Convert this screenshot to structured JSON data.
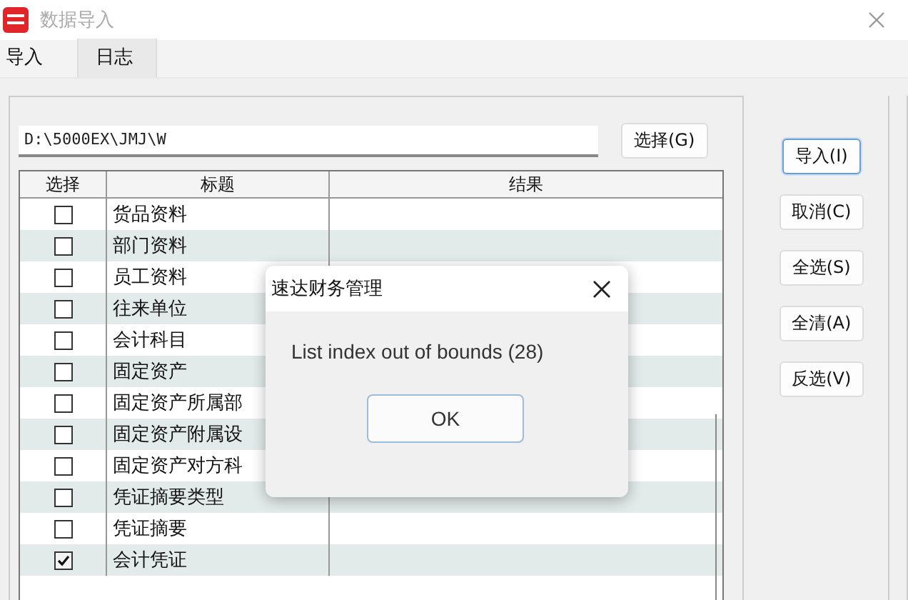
{
  "window": {
    "title": "数据导入"
  },
  "tabs": [
    {
      "label": "导入",
      "selected": true
    },
    {
      "label": "日志",
      "selected": false
    }
  ],
  "path_field": {
    "value": "D:\\5000EX\\JMJ\\W"
  },
  "browse_button": "选择(G)",
  "table": {
    "columns": [
      "选择",
      "标题",
      "结果"
    ],
    "rows": [
      {
        "title": "货品资料",
        "checked": false
      },
      {
        "title": "部门资料",
        "checked": false
      },
      {
        "title": "员工资料",
        "checked": false
      },
      {
        "title": "往来单位",
        "checked": false
      },
      {
        "title": "会计科目",
        "checked": false
      },
      {
        "title": "固定资产",
        "checked": false
      },
      {
        "title": "固定资产所属部",
        "checked": false
      },
      {
        "title": "固定资产附属设",
        "checked": false
      },
      {
        "title": "固定资产对方科",
        "checked": false
      },
      {
        "title": "凭证摘要类型",
        "checked": false
      },
      {
        "title": "凭证摘要",
        "checked": false
      },
      {
        "title": "会计凭证",
        "checked": true
      }
    ]
  },
  "side_buttons": [
    {
      "label": "导入(I)",
      "selected": true
    },
    {
      "label": "取消(C)",
      "selected": false
    },
    {
      "label": "全选(S)",
      "selected": false
    },
    {
      "label": "全清(A)",
      "selected": false
    },
    {
      "label": "反选(V)",
      "selected": false
    }
  ],
  "dialog": {
    "title": "速达财务管理",
    "message": "List index out of bounds (28)",
    "button": "OK"
  }
}
